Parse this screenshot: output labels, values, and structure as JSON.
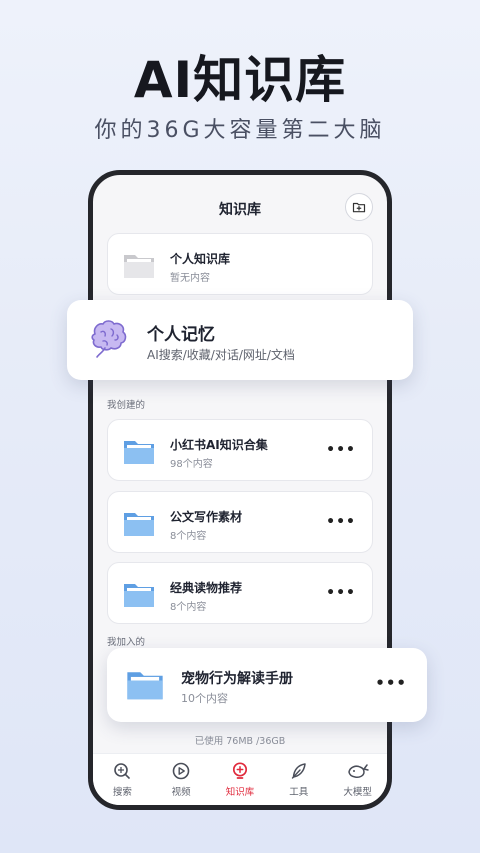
{
  "hero": {
    "title": "AI知识库",
    "subtitle": "你的36G大容量第二大脑"
  },
  "app": {
    "title": "知识库",
    "add_icon": "folder-plus-icon",
    "personal_kb": {
      "name": "个人知识库",
      "meta": "暂无内容"
    },
    "memory": {
      "name": "个人记忆",
      "desc": "AI搜索/收藏/对话/网址/文档",
      "icon": "brain-icon"
    },
    "created_label": "我创建的",
    "created": [
      {
        "name": "小红书AI知识合集",
        "meta": "98个内容"
      },
      {
        "name": "公文写作素材",
        "meta": "8个内容"
      },
      {
        "name": "经典读物推荐",
        "meta": "8个内容"
      }
    ],
    "joined_label": "我加入的",
    "joined": [
      {
        "name": "宠物行为解读手册",
        "meta": "10个内容"
      }
    ],
    "more_label": "•••",
    "storage": "已使用 76MB /36GB",
    "tabs": [
      {
        "label": "搜索",
        "icon": "ai-search-icon"
      },
      {
        "label": "视频",
        "icon": "play-icon"
      },
      {
        "label": "知识库",
        "icon": "bulb-icon",
        "active": true
      },
      {
        "label": "工具",
        "icon": "feather-icon"
      },
      {
        "label": "大模型",
        "icon": "whale-icon"
      }
    ]
  },
  "colors": {
    "accent": "#e02a3c",
    "folder_blue": "#7fb5ee",
    "folder_gray": "#d9d9dc",
    "brain_purple": "#b7a6ec"
  }
}
